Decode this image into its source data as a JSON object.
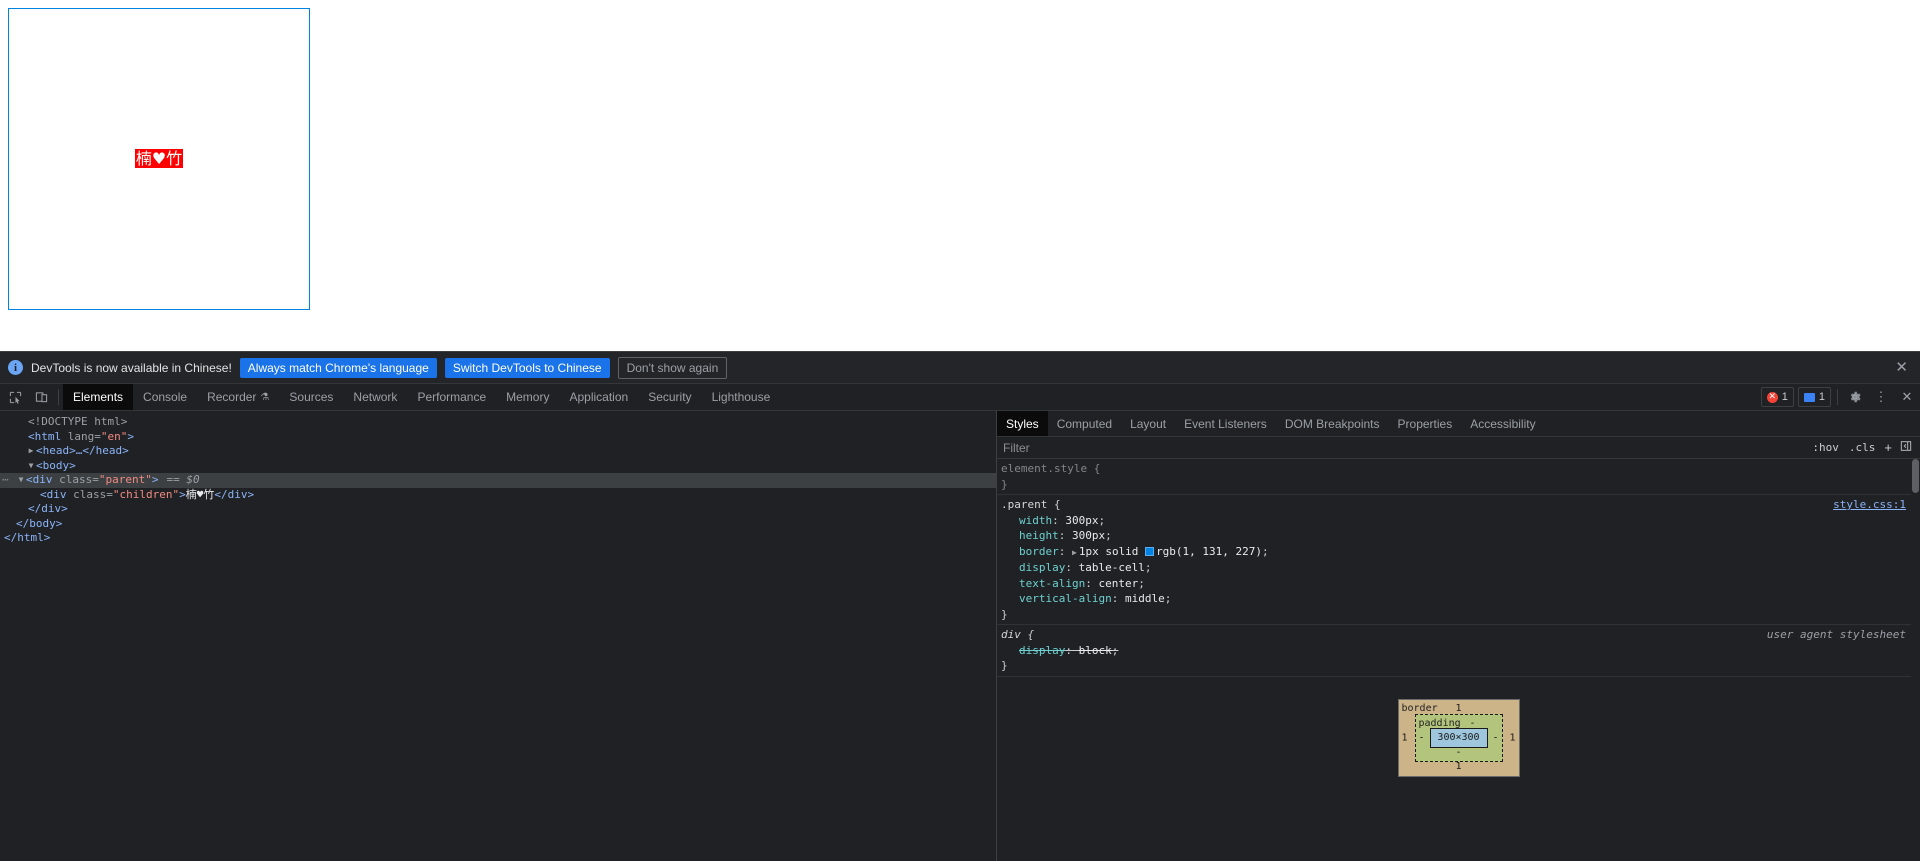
{
  "page": {
    "parent_text": "",
    "children_text": "楠♥竹"
  },
  "infobar": {
    "icon": "info-icon",
    "message": "DevTools is now available in Chinese!",
    "primary_button": "Always match Chrome's language",
    "secondary_button": "Switch DevTools to Chinese",
    "dismiss_button": "Don't show again",
    "close_icon": "✕"
  },
  "tabstrip": {
    "inspect_icon": "inspect-element-icon",
    "device_icon": "device-toolbar-icon",
    "tabs": [
      {
        "label": "Elements",
        "active": true
      },
      {
        "label": "Console",
        "active": false
      },
      {
        "label": "Recorder",
        "active": false,
        "badge": "⚗"
      },
      {
        "label": "Sources",
        "active": false
      },
      {
        "label": "Network",
        "active": false
      },
      {
        "label": "Performance",
        "active": false
      },
      {
        "label": "Memory",
        "active": false
      },
      {
        "label": "Application",
        "active": false
      },
      {
        "label": "Security",
        "active": false
      },
      {
        "label": "Lighthouse",
        "active": false
      }
    ],
    "error_count": "1",
    "message_count": "1",
    "settings_icon": "gear-icon",
    "more_icon": "kebab-menu-icon",
    "close_icon": "✕"
  },
  "dom_tree": {
    "rows": [
      {
        "indent": 0,
        "triangle": "",
        "content": "doctype"
      },
      {
        "indent": 0,
        "triangle": "",
        "content": "html_open"
      },
      {
        "indent": 1,
        "triangle": "▶",
        "content": "head"
      },
      {
        "indent": 1,
        "triangle": "▼",
        "content": "body_open"
      },
      {
        "indent": 2,
        "triangle": "▼",
        "content": "parent_open",
        "selected": true
      },
      {
        "indent": 3,
        "triangle": "",
        "content": "children"
      },
      {
        "indent": 2,
        "triangle": "",
        "content": "parent_close"
      },
      {
        "indent": 1,
        "triangle": "",
        "content": "body_close"
      },
      {
        "indent": 0,
        "triangle": "",
        "content": "html_close"
      }
    ],
    "text": {
      "doctype": "<!DOCTYPE html>",
      "html_tag": "html",
      "html_attr_name": "lang",
      "html_attr_value": "\"en\"",
      "head_collapsed": "<head>…</head>",
      "body_tag": "body",
      "div_tag": "div",
      "class_attr": "class",
      "parent_class": "\"parent\"",
      "children_class": "\"children\"",
      "children_text": "楠♥竹",
      "selected_ref": "== $0",
      "close_div": "</div>",
      "close_body": "</body>",
      "close_html": "</html>"
    }
  },
  "styles_panel": {
    "tabs": [
      {
        "label": "Styles",
        "active": true
      },
      {
        "label": "Computed",
        "active": false
      },
      {
        "label": "Layout",
        "active": false
      },
      {
        "label": "Event Listeners",
        "active": false
      },
      {
        "label": "DOM Breakpoints",
        "active": false
      },
      {
        "label": "Properties",
        "active": false
      },
      {
        "label": "Accessibility",
        "active": false
      }
    ],
    "filter_placeholder": "Filter",
    "filter_value": "",
    "hov_button": ":hov",
    "cls_button": ".cls",
    "new_rule_button": "+",
    "sidebar_toggle_icon": "toggle-sidebar-icon",
    "rules": [
      {
        "selector": "element.style",
        "origin": "",
        "declarations": []
      },
      {
        "selector": ".parent",
        "origin": "style.css:1",
        "declarations": [
          {
            "name": "width",
            "value": "300px",
            "disabled": false
          },
          {
            "name": "height",
            "value": "300px",
            "disabled": false
          },
          {
            "name": "border",
            "value": "1px solid rgb(1, 131, 227)",
            "disabled": false,
            "swatch": "#0183e3",
            "expandable": true
          },
          {
            "name": "display",
            "value": "table-cell",
            "disabled": false
          },
          {
            "name": "text-align",
            "value": "center",
            "disabled": false
          },
          {
            "name": "vertical-align",
            "value": "middle",
            "disabled": false
          }
        ]
      },
      {
        "selector": "div",
        "origin": "user agent stylesheet",
        "declarations": [
          {
            "name": "display",
            "value": "block",
            "disabled": true
          }
        ]
      }
    ]
  },
  "box_model": {
    "border_label": "border",
    "padding_label": "padding",
    "content_size": "300×300",
    "border_top": "1",
    "border_right": "1",
    "border_bottom": "1",
    "border_left": "1",
    "padding_top": "-",
    "padding_right": "-",
    "padding_bottom": "-",
    "padding_left": "-"
  },
  "colors": {
    "accent_blue": "#1a73e8",
    "border_blue": "#0183e3",
    "child_red": "#ff0000",
    "devtools_bg": "#202124",
    "box_border": "#cdb388",
    "box_padding": "#b3c47d",
    "box_content": "#9ec7dd"
  }
}
